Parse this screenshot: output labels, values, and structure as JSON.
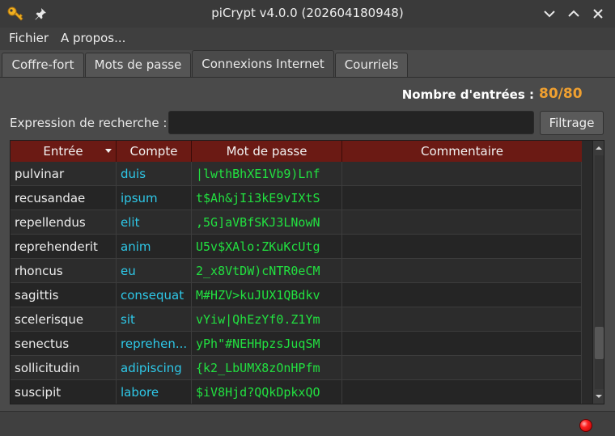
{
  "window": {
    "title": "piCrypt v4.0.0 (202604180948)",
    "icons": {
      "app": "key-icon",
      "pin": "pin-icon",
      "minimize": "chevron-down-icon",
      "maximize": "chevron-up-icon",
      "close": "close-icon"
    }
  },
  "menu": {
    "items": [
      "Fichier",
      "A propos..."
    ]
  },
  "tabs": [
    {
      "label": "Coffre-fort",
      "active": false
    },
    {
      "label": "Mots de passe",
      "active": false
    },
    {
      "label": "Connexions Internet",
      "active": true
    },
    {
      "label": "Courriels",
      "active": false
    }
  ],
  "summary": {
    "label": "Nombre d'entrées :",
    "value": "80/80"
  },
  "search": {
    "label": "Expression de recherche :",
    "value": "",
    "button": "Filtrage"
  },
  "table": {
    "columns": [
      "Entrée",
      "Compte",
      "Mot de passe",
      "Commentaire"
    ],
    "sort_column": "Entrée",
    "rows": [
      {
        "entry": "pulvinar",
        "account": "duis",
        "password": "|lwthBhXE1Vb9)Lnf",
        "comment": ""
      },
      {
        "entry": "recusandae",
        "account": "ipsum",
        "password": "t$Ah&jIi3kE9vIXtS",
        "comment": ""
      },
      {
        "entry": "repellendus",
        "account": "elit",
        "password": ",5G]aVBfSKJ3LNowN",
        "comment": ""
      },
      {
        "entry": "reprehenderit",
        "account": "anim",
        "password": "U5v$XAlo:ZKuKcUtg",
        "comment": ""
      },
      {
        "entry": "rhoncus",
        "account": "eu",
        "password": "2_x8VtDW)cNTR0eCM",
        "comment": ""
      },
      {
        "entry": "sagittis",
        "account": "consequat",
        "password": "M#HZV>kuJUX1QBdkv",
        "comment": ""
      },
      {
        "entry": "scelerisque",
        "account": "sit",
        "password": "vYiw|QhEzYf0.Z1Ym",
        "comment": ""
      },
      {
        "entry": "senectus",
        "account": "reprehen...",
        "password": "yPh\"#NEHHpzsJuqSM",
        "comment": ""
      },
      {
        "entry": "sollicitudin",
        "account": "adipiscing",
        "password": "{k2_LbUMX8zOnHPfm",
        "comment": ""
      },
      {
        "entry": "suscipit",
        "account": "labore",
        "password": "$iV8Hjd?QQkDpkxQO",
        "comment": ""
      }
    ]
  },
  "colors": {
    "header_bg": "#6b1a14",
    "account_text": "#2ec8e8",
    "password_text": "#22e040",
    "count_value": "#f0a030",
    "status_led": "#ff2020"
  },
  "status": {
    "indicator": "red-status-icon"
  }
}
